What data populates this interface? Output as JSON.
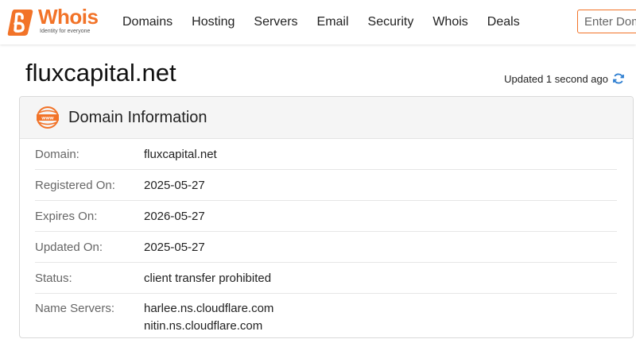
{
  "header": {
    "logo_text": "Whois",
    "logo_tagline": "Identity for everyone",
    "nav": [
      "Domains",
      "Hosting",
      "Servers",
      "Email",
      "Security",
      "Whois",
      "Deals"
    ],
    "search_placeholder": "Enter Domain"
  },
  "page": {
    "domain": "fluxcapital.net",
    "updated": "Updated 1 second ago"
  },
  "card": {
    "title": "Domain Information",
    "rows": [
      {
        "label": "Domain:",
        "value": "fluxcapital.net"
      },
      {
        "label": "Registered On:",
        "value": "2025-05-27"
      },
      {
        "label": "Expires On:",
        "value": "2026-05-27"
      },
      {
        "label": "Updated On:",
        "value": "2025-05-27"
      },
      {
        "label": "Status:",
        "value": "client transfer prohibited"
      }
    ],
    "name_servers": {
      "label": "Name Servers:",
      "values": [
        "harlee.ns.cloudflare.com",
        "nitin.ns.cloudflare.com"
      ]
    }
  },
  "icons": {
    "logo": "whois-logo-icon",
    "refresh": "refresh-icon",
    "www": "www-globe-icon"
  },
  "colors": {
    "brand": "#f27328",
    "refresh": "#2f7fd1"
  }
}
